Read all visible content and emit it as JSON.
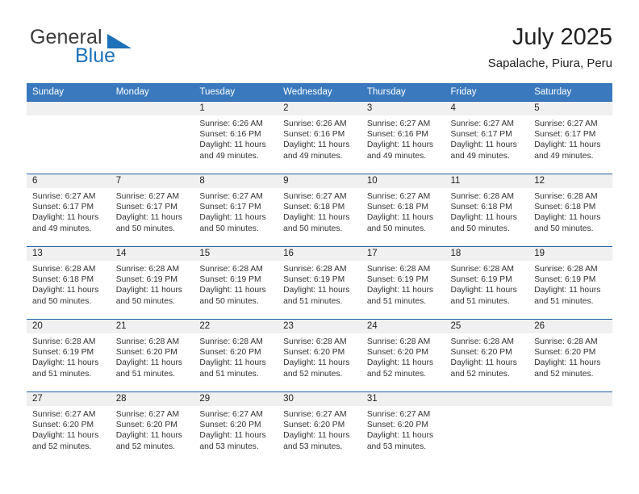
{
  "brand": {
    "name_part1": "General",
    "name_part2": "Blue",
    "logo_icon": "triangle-logo-icon"
  },
  "header": {
    "title": "July 2025",
    "subtitle": "Sapalache, Piura, Peru"
  },
  "colors": {
    "header_blue": "#3a79bd",
    "separator_blue": "#1f5fa9",
    "daynum_band": "#f0f0f0",
    "brand_blue": "#1c71b8"
  },
  "weekday_headers": [
    "Sunday",
    "Monday",
    "Tuesday",
    "Wednesday",
    "Thursday",
    "Friday",
    "Saturday"
  ],
  "weeks": [
    [
      {
        "day": "",
        "empty": true,
        "sunrise": "",
        "sunset": "",
        "daylight": ""
      },
      {
        "day": "",
        "empty": true,
        "sunrise": "",
        "sunset": "",
        "daylight": ""
      },
      {
        "day": "1",
        "empty": false,
        "sunrise": "Sunrise: 6:26 AM",
        "sunset": "Sunset: 6:16 PM",
        "daylight": "Daylight: 11 hours and 49 minutes."
      },
      {
        "day": "2",
        "empty": false,
        "sunrise": "Sunrise: 6:26 AM",
        "sunset": "Sunset: 6:16 PM",
        "daylight": "Daylight: 11 hours and 49 minutes."
      },
      {
        "day": "3",
        "empty": false,
        "sunrise": "Sunrise: 6:27 AM",
        "sunset": "Sunset: 6:16 PM",
        "daylight": "Daylight: 11 hours and 49 minutes."
      },
      {
        "day": "4",
        "empty": false,
        "sunrise": "Sunrise: 6:27 AM",
        "sunset": "Sunset: 6:17 PM",
        "daylight": "Daylight: 11 hours and 49 minutes."
      },
      {
        "day": "5",
        "empty": false,
        "sunrise": "Sunrise: 6:27 AM",
        "sunset": "Sunset: 6:17 PM",
        "daylight": "Daylight: 11 hours and 49 minutes."
      }
    ],
    [
      {
        "day": "6",
        "empty": false,
        "sunrise": "Sunrise: 6:27 AM",
        "sunset": "Sunset: 6:17 PM",
        "daylight": "Daylight: 11 hours and 49 minutes."
      },
      {
        "day": "7",
        "empty": false,
        "sunrise": "Sunrise: 6:27 AM",
        "sunset": "Sunset: 6:17 PM",
        "daylight": "Daylight: 11 hours and 50 minutes."
      },
      {
        "day": "8",
        "empty": false,
        "sunrise": "Sunrise: 6:27 AM",
        "sunset": "Sunset: 6:17 PM",
        "daylight": "Daylight: 11 hours and 50 minutes."
      },
      {
        "day": "9",
        "empty": false,
        "sunrise": "Sunrise: 6:27 AM",
        "sunset": "Sunset: 6:18 PM",
        "daylight": "Daylight: 11 hours and 50 minutes."
      },
      {
        "day": "10",
        "empty": false,
        "sunrise": "Sunrise: 6:27 AM",
        "sunset": "Sunset: 6:18 PM",
        "daylight": "Daylight: 11 hours and 50 minutes."
      },
      {
        "day": "11",
        "empty": false,
        "sunrise": "Sunrise: 6:28 AM",
        "sunset": "Sunset: 6:18 PM",
        "daylight": "Daylight: 11 hours and 50 minutes."
      },
      {
        "day": "12",
        "empty": false,
        "sunrise": "Sunrise: 6:28 AM",
        "sunset": "Sunset: 6:18 PM",
        "daylight": "Daylight: 11 hours and 50 minutes."
      }
    ],
    [
      {
        "day": "13",
        "empty": false,
        "sunrise": "Sunrise: 6:28 AM",
        "sunset": "Sunset: 6:18 PM",
        "daylight": "Daylight: 11 hours and 50 minutes."
      },
      {
        "day": "14",
        "empty": false,
        "sunrise": "Sunrise: 6:28 AM",
        "sunset": "Sunset: 6:19 PM",
        "daylight": "Daylight: 11 hours and 50 minutes."
      },
      {
        "day": "15",
        "empty": false,
        "sunrise": "Sunrise: 6:28 AM",
        "sunset": "Sunset: 6:19 PM",
        "daylight": "Daylight: 11 hours and 50 minutes."
      },
      {
        "day": "16",
        "empty": false,
        "sunrise": "Sunrise: 6:28 AM",
        "sunset": "Sunset: 6:19 PM",
        "daylight": "Daylight: 11 hours and 51 minutes."
      },
      {
        "day": "17",
        "empty": false,
        "sunrise": "Sunrise: 6:28 AM",
        "sunset": "Sunset: 6:19 PM",
        "daylight": "Daylight: 11 hours and 51 minutes."
      },
      {
        "day": "18",
        "empty": false,
        "sunrise": "Sunrise: 6:28 AM",
        "sunset": "Sunset: 6:19 PM",
        "daylight": "Daylight: 11 hours and 51 minutes."
      },
      {
        "day": "19",
        "empty": false,
        "sunrise": "Sunrise: 6:28 AM",
        "sunset": "Sunset: 6:19 PM",
        "daylight": "Daylight: 11 hours and 51 minutes."
      }
    ],
    [
      {
        "day": "20",
        "empty": false,
        "sunrise": "Sunrise: 6:28 AM",
        "sunset": "Sunset: 6:19 PM",
        "daylight": "Daylight: 11 hours and 51 minutes."
      },
      {
        "day": "21",
        "empty": false,
        "sunrise": "Sunrise: 6:28 AM",
        "sunset": "Sunset: 6:20 PM",
        "daylight": "Daylight: 11 hours and 51 minutes."
      },
      {
        "day": "22",
        "empty": false,
        "sunrise": "Sunrise: 6:28 AM",
        "sunset": "Sunset: 6:20 PM",
        "daylight": "Daylight: 11 hours and 51 minutes."
      },
      {
        "day": "23",
        "empty": false,
        "sunrise": "Sunrise: 6:28 AM",
        "sunset": "Sunset: 6:20 PM",
        "daylight": "Daylight: 11 hours and 52 minutes."
      },
      {
        "day": "24",
        "empty": false,
        "sunrise": "Sunrise: 6:28 AM",
        "sunset": "Sunset: 6:20 PM",
        "daylight": "Daylight: 11 hours and 52 minutes."
      },
      {
        "day": "25",
        "empty": false,
        "sunrise": "Sunrise: 6:28 AM",
        "sunset": "Sunset: 6:20 PM",
        "daylight": "Daylight: 11 hours and 52 minutes."
      },
      {
        "day": "26",
        "empty": false,
        "sunrise": "Sunrise: 6:28 AM",
        "sunset": "Sunset: 6:20 PM",
        "daylight": "Daylight: 11 hours and 52 minutes."
      }
    ],
    [
      {
        "day": "27",
        "empty": false,
        "sunrise": "Sunrise: 6:27 AM",
        "sunset": "Sunset: 6:20 PM",
        "daylight": "Daylight: 11 hours and 52 minutes."
      },
      {
        "day": "28",
        "empty": false,
        "sunrise": "Sunrise: 6:27 AM",
        "sunset": "Sunset: 6:20 PM",
        "daylight": "Daylight: 11 hours and 52 minutes."
      },
      {
        "day": "29",
        "empty": false,
        "sunrise": "Sunrise: 6:27 AM",
        "sunset": "Sunset: 6:20 PM",
        "daylight": "Daylight: 11 hours and 53 minutes."
      },
      {
        "day": "30",
        "empty": false,
        "sunrise": "Sunrise: 6:27 AM",
        "sunset": "Sunset: 6:20 PM",
        "daylight": "Daylight: 11 hours and 53 minutes."
      },
      {
        "day": "31",
        "empty": false,
        "sunrise": "Sunrise: 6:27 AM",
        "sunset": "Sunset: 6:20 PM",
        "daylight": "Daylight: 11 hours and 53 minutes."
      },
      {
        "day": "",
        "empty": true,
        "sunrise": "",
        "sunset": "",
        "daylight": ""
      },
      {
        "day": "",
        "empty": true,
        "sunrise": "",
        "sunset": "",
        "daylight": ""
      }
    ]
  ]
}
